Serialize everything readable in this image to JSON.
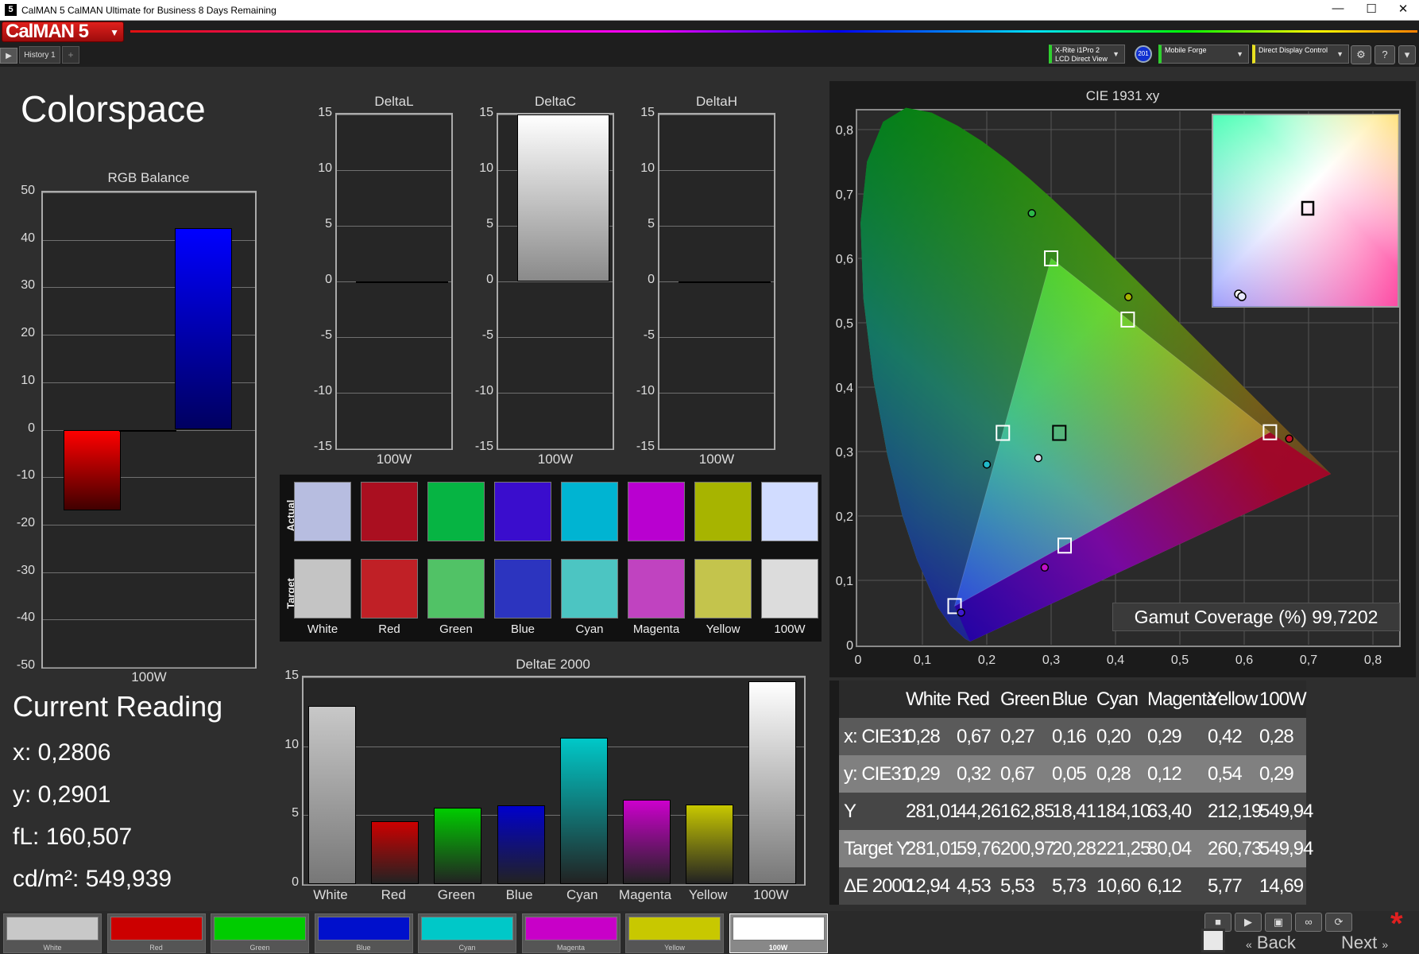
{
  "window": {
    "title": "CalMAN 5 CalMAN Ultimate for Business 8 Days Remaining",
    "app_icon": "5",
    "minimize": "—",
    "maximize": "☐",
    "close": "✕"
  },
  "header": {
    "logo": "CalMAN 5",
    "history_tab": "History 1",
    "add_tab": "+",
    "devices": [
      {
        "line1": "X-Rite i1Pro 2",
        "line2": "LCD Direct View",
        "accent": "#2fd02f"
      },
      {
        "line1": "Mobile Forge",
        "line2": "",
        "accent": "#2fd02f"
      },
      {
        "line1": "Direct Display Control",
        "line2": "",
        "accent": "#e8e020"
      }
    ],
    "badge": "201"
  },
  "page": {
    "title": "Colorspace"
  },
  "rgb_balance": {
    "title": "RGB Balance",
    "ticks": [
      "50",
      "40",
      "30",
      "20",
      "10",
      "0",
      "-10",
      "-20",
      "-30",
      "-40",
      "-50"
    ],
    "category": "100W"
  },
  "deltas": [
    {
      "title": "DeltaL",
      "category": "100W",
      "ticks": [
        "15",
        "10",
        "5",
        "0",
        "-5",
        "-10",
        "-15"
      ]
    },
    {
      "title": "DeltaC",
      "category": "100W",
      "ticks": [
        "15",
        "10",
        "5",
        "0",
        "-5",
        "-10",
        "-15"
      ]
    },
    {
      "title": "DeltaH",
      "category": "100W",
      "ticks": [
        "15",
        "10",
        "5",
        "0",
        "-5",
        "-10",
        "-15"
      ]
    }
  ],
  "swatches": {
    "actual_label": "Actual",
    "target_label": "Target",
    "items": [
      {
        "name": "White",
        "actual": "#b7bde0",
        "target": "#c4c4c4"
      },
      {
        "name": "Red",
        "actual": "#aa0f20",
        "target": "#c02026"
      },
      {
        "name": "Green",
        "actual": "#06b443",
        "target": "#51c266"
      },
      {
        "name": "Blue",
        "actual": "#3a0dcd",
        "target": "#2c34bf"
      },
      {
        "name": "Cyan",
        "actual": "#00b4d2",
        "target": "#4cc5c2"
      },
      {
        "name": "Magenta",
        "actual": "#b900d0",
        "target": "#c043c0"
      },
      {
        "name": "Yellow",
        "actual": "#a7b400",
        "target": "#c4c44c"
      },
      {
        "name": "100W",
        "actual": "#d1dcff",
        "target": "#dcdcdc"
      }
    ]
  },
  "current_reading": {
    "title": "Current Reading",
    "x": "x: 0,2806",
    "y": "y: 0,2901",
    "fl": "fL: 160,507",
    "cdm2": "cd/m²: 549,939"
  },
  "cie": {
    "title": "CIE 1931 xy",
    "x_ticks": [
      "0",
      "0,1",
      "0,2",
      "0,3",
      "0,4",
      "0,5",
      "0,6",
      "0,7",
      "0,8"
    ],
    "y_ticks": [
      "0,8",
      "0,7",
      "0,6",
      "0,5",
      "0,4",
      "0,3",
      "0,2",
      "0,1",
      "0"
    ]
  },
  "gamut_coverage": "Gamut Coverage (%) 99,7202",
  "table": {
    "headers": [
      "",
      "White",
      "Red",
      "Green",
      "Blue",
      "Cyan",
      "Magenta",
      "Yellow",
      "100W"
    ],
    "rows": [
      [
        "x: CIE31",
        "0,28",
        "0,67",
        "0,27",
        "0,16",
        "0,20",
        "0,29",
        "0,42",
        "0,28"
      ],
      [
        "y: CIE31",
        "0,29",
        "0,32",
        "0,67",
        "0,05",
        "0,28",
        "0,12",
        "0,54",
        "0,29"
      ],
      [
        "Y",
        "281,01",
        "44,26",
        "162,85",
        "18,41",
        "184,10",
        "63,40",
        "212,19",
        "549,94"
      ],
      [
        "Target Y",
        "281,01",
        "59,76",
        "200,97",
        "20,28",
        "221,25",
        "80,04",
        "260,73",
        "549,94"
      ],
      [
        "ΔE 2000",
        "12,94",
        "4,53",
        "5,53",
        "5,73",
        "10,60",
        "6,12",
        "5,77",
        "14,69"
      ]
    ]
  },
  "bottom_swatches": [
    {
      "label": "White",
      "color": "#c8c8c8"
    },
    {
      "label": "Red",
      "color": "#cc0000"
    },
    {
      "label": "Green",
      "color": "#00cc00"
    },
    {
      "label": "Blue",
      "color": "#0010cc"
    },
    {
      "label": "Cyan",
      "color": "#00c8c8"
    },
    {
      "label": "Magenta",
      "color": "#c800c8"
    },
    {
      "label": "Yellow",
      "color": "#c8c800"
    },
    {
      "label": "100W",
      "color": "#ffffff"
    }
  ],
  "nav": {
    "back": "Back",
    "next": "Next"
  },
  "chart_data": [
    {
      "type": "bar",
      "title": "RGB Balance",
      "categories": [
        "100W"
      ],
      "series": [
        {
          "name": "Red",
          "values": [
            -17
          ],
          "color": "#ff0000"
        },
        {
          "name": "Green",
          "values": [
            0
          ],
          "color": "#00ff00"
        },
        {
          "name": "Blue",
          "values": [
            42.5
          ],
          "color": "#0000ff"
        }
      ],
      "ylim": [
        -50,
        50
      ]
    },
    {
      "type": "bar",
      "title": "DeltaL",
      "categories": [
        "100W"
      ],
      "values": [
        0
      ],
      "ylim": [
        -15,
        15
      ]
    },
    {
      "type": "bar",
      "title": "DeltaC",
      "categories": [
        "100W"
      ],
      "values": [
        15
      ],
      "ylim": [
        -15,
        15
      ]
    },
    {
      "type": "bar",
      "title": "DeltaH",
      "categories": [
        "100W"
      ],
      "values": [
        0
      ],
      "ylim": [
        -15,
        15
      ]
    },
    {
      "type": "bar",
      "title": "DeltaE 2000",
      "categories": [
        "White",
        "Red",
        "Green",
        "Blue",
        "Cyan",
        "Magenta",
        "Yellow",
        "100W"
      ],
      "values": [
        12.94,
        4.53,
        5.53,
        5.73,
        10.6,
        6.12,
        5.77,
        14.69
      ],
      "colors": [
        "#c8c8c8",
        "#cc0000",
        "#00cc00",
        "#0000cc",
        "#00c8c8",
        "#cc00cc",
        "#c8c800",
        "#ffffff"
      ],
      "ylim": [
        0,
        15
      ],
      "yticks": [
        "15",
        "10",
        "5",
        "0"
      ]
    },
    {
      "type": "scatter",
      "title": "CIE 1931 xy",
      "xlim": [
        0,
        0.85
      ],
      "ylim": [
        0,
        0.85
      ],
      "target_points": [
        {
          "name": "Red",
          "x": 0.64,
          "y": 0.33
        },
        {
          "name": "Green",
          "x": 0.3,
          "y": 0.6
        },
        {
          "name": "Blue",
          "x": 0.15,
          "y": 0.06
        },
        {
          "name": "White",
          "x": 0.3127,
          "y": 0.329
        },
        {
          "name": "Cyan",
          "x": 0.225,
          "y": 0.329
        },
        {
          "name": "Magenta",
          "x": 0.321,
          "y": 0.154
        },
        {
          "name": "Yellow",
          "x": 0.419,
          "y": 0.505
        }
      ],
      "measured_points": [
        {
          "name": "Red",
          "x": 0.67,
          "y": 0.32,
          "color": "#c8102a"
        },
        {
          "name": "Green",
          "x": 0.27,
          "y": 0.67,
          "color": "#2db84a"
        },
        {
          "name": "Blue",
          "x": 0.16,
          "y": 0.05,
          "color": "#3f1ad0"
        },
        {
          "name": "White",
          "x": 0.28,
          "y": 0.29,
          "color": "#e0e0f0"
        },
        {
          "name": "Cyan",
          "x": 0.2,
          "y": 0.28,
          "color": "#20b8c8"
        },
        {
          "name": "Magenta",
          "x": 0.29,
          "y": 0.12,
          "color": "#c010c8"
        },
        {
          "name": "Yellow",
          "x": 0.42,
          "y": 0.54,
          "color": "#a8b400"
        }
      ]
    }
  ]
}
